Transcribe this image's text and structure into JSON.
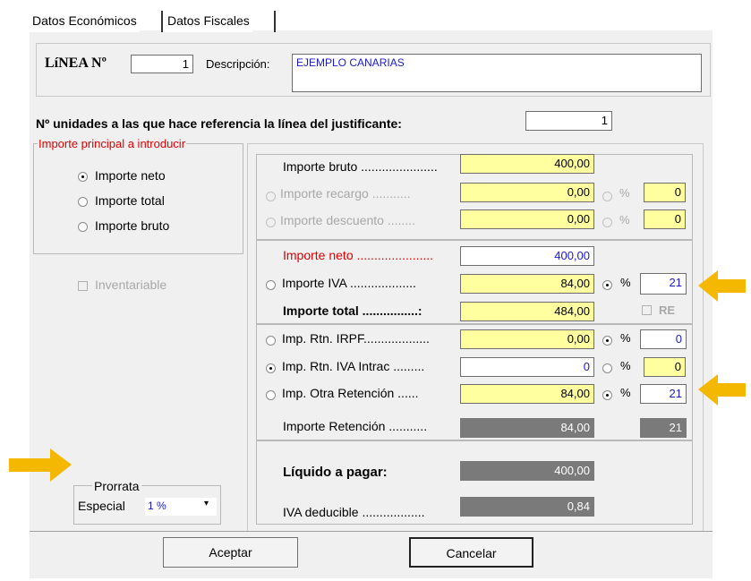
{
  "tabs": [
    "Datos Económicos",
    "Datos Fiscales"
  ],
  "linea": {
    "label": "LíNEA Nº",
    "value": "1",
    "descripcion_label": "Descripción:",
    "descripcion_value": "EJEMPLO CANARIAS"
  },
  "unidades": {
    "label": "Nº unidades a las que hace referencia la línea del justificante:",
    "value": "1"
  },
  "importe_principal": {
    "title": "Importe principal a introducir",
    "options": [
      "Importe neto",
      "Importe total",
      "Importe bruto"
    ],
    "selected": "Importe neto"
  },
  "inventariable": {
    "label": "Inventariable",
    "checked": false
  },
  "prorrata": {
    "title": "Prorrata",
    "label": "Especial",
    "value": "1 %"
  },
  "rows": {
    "bruto": {
      "label": "Importe bruto ",
      "dots": "......................",
      "value": "400,00"
    },
    "recargo": {
      "label": "Importe recargo ",
      "dots": "...........",
      "value": "0,00",
      "pct_symbol": "%",
      "pct": "0"
    },
    "descuento": {
      "label": "Importe descuento ",
      "dots": "........",
      "value": "0,00",
      "pct_symbol": "%",
      "pct": "0"
    },
    "neto": {
      "label": "Importe neto ",
      "dots": "......................",
      "value": "400,00"
    },
    "iva": {
      "label": "Importe IVA ",
      "dots": "...................",
      "value": "84,00",
      "pct_symbol": "%",
      "pct": "21"
    },
    "total": {
      "label": "Importe total ",
      "dots": "................:",
      "value": "484,00",
      "re_label": "RE"
    },
    "irpf": {
      "label": "Imp. Rtn. IRPF",
      "dots": "...................",
      "value": "0,00",
      "pct_symbol": "%",
      "pct": "0"
    },
    "iva_intrac": {
      "label": "Imp. Rtn. IVA Intrac ",
      "dots": ".........",
      "value": "0",
      "pct_symbol": "%",
      "pct": "0"
    },
    "otra": {
      "label": "Imp. Otra Retención ",
      "dots": "......",
      "value": "84,00",
      "pct_symbol": "%",
      "pct": "21"
    },
    "retencion": {
      "label": "Importe Retención ",
      "dots": "...........",
      "value": "84,00",
      "pct": "21"
    },
    "liquido": {
      "label": "Líquido a pagar:",
      "value": "400,00"
    },
    "deducible": {
      "label": "IVA deducible ",
      "dots": "..................",
      "value": "0,84"
    }
  },
  "buttons": {
    "aceptar": "Aceptar",
    "cancelar": "Cancelar"
  },
  "colors": {
    "yellow_field": "#ffffa0",
    "gray_field": "#7a7a7a",
    "arrow": "#f5b800",
    "red_label": "#e00000",
    "blue_text": "#1a1acc"
  }
}
